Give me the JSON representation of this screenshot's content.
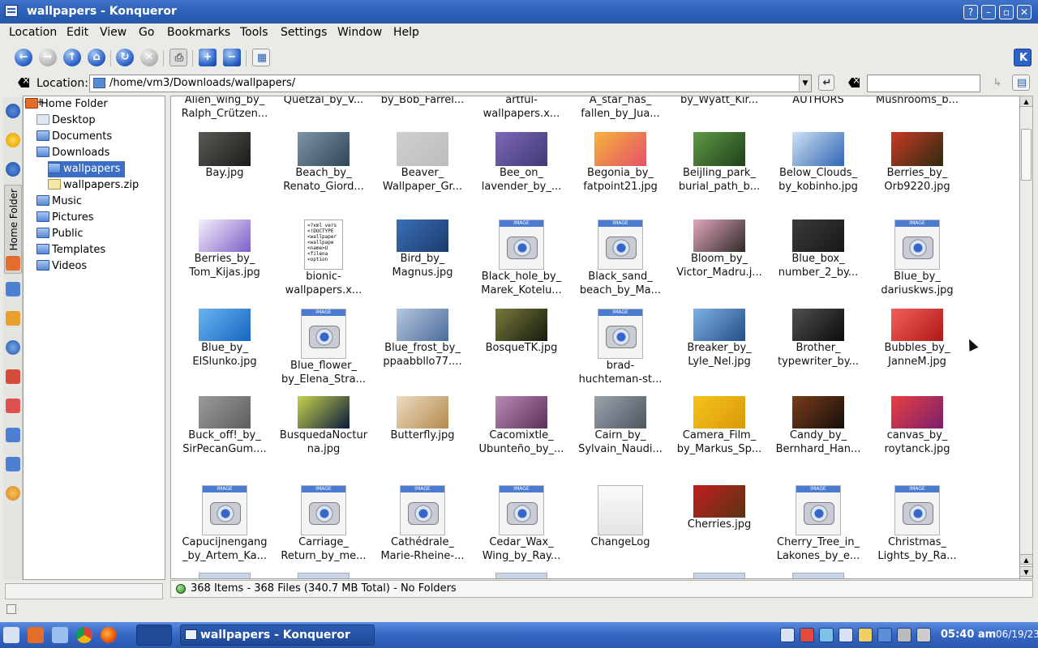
{
  "window": {
    "title": "wallpapers - Konqueror"
  },
  "menu": [
    "Location",
    "Edit",
    "View",
    "Go",
    "Bookmarks",
    "Tools",
    "Settings",
    "Window",
    "Help"
  ],
  "location": {
    "label": "Location:",
    "path": "/home/vm3/Downloads/wallpapers/"
  },
  "sidebar_tab": "Home Folder",
  "tree": [
    {
      "label": "Home Folder"
    },
    {
      "label": "Desktop"
    },
    {
      "label": "Documents"
    },
    {
      "label": "Downloads"
    },
    {
      "label": "wallpapers"
    },
    {
      "label": "wallpapers.zip"
    },
    {
      "label": "Music"
    },
    {
      "label": "Pictures"
    },
    {
      "label": "Public"
    },
    {
      "label": "Templates"
    },
    {
      "label": "Videos"
    }
  ],
  "rows": [
    [
      {
        "l1": "Alien_wing_by_",
        "l2": "Ralph_Crützen..."
      },
      {
        "l1": "Quetzal_by_V...",
        "l2": ""
      },
      {
        "l1": "by_Bob_Farrel...",
        "l2": ""
      },
      {
        "l1": "artful-",
        "l2": "wallpapers.x..."
      },
      {
        "l1": "A_star_has_",
        "l2": "fallen_by_Jua..."
      },
      {
        "l1": "by_Wyatt_Kir...",
        "l2": ""
      },
      {
        "l1": "AUTHORS",
        "l2": ""
      },
      {
        "l1": "Mushrooms_b...",
        "l2": ""
      }
    ],
    [
      {
        "l1": "Bay.jpg",
        "l2": "",
        "c1": "#5b5955",
        "c2": "#1c1b19"
      },
      {
        "l1": "Beach_by_",
        "l2": "Renato_Giord...",
        "c1": "#7f93a6",
        "c2": "#2f4659"
      },
      {
        "l1": "Beaver_",
        "l2": "Wallpaper_Gr...",
        "c1": "#cfcfcf",
        "c2": "#bdbdbd"
      },
      {
        "l1": "Bee_on_",
        "l2": "lavender_by_...",
        "c1": "#7d68b8",
        "c2": "#3f3a75"
      },
      {
        "l1": "Begonia_by_",
        "l2": "fatpoint21.jpg",
        "c1": "#f6b33a",
        "c2": "#e5506a"
      },
      {
        "l1": "Beijling_park_",
        "l2": "burial_path_b...",
        "c1": "#5d9a45",
        "c2": "#20401b"
      },
      {
        "l1": "Below_Clouds_",
        "l2": "by_kobinho.jpg",
        "c1": "#cfe1f6",
        "c2": "#2f66b2"
      },
      {
        "l1": "Berries_by_",
        "l2": "Orb9220.jpg",
        "c1": "#c93a22",
        "c2": "#2d2a12"
      }
    ],
    [
      {
        "l1": "Berries_by_",
        "l2": "Tom_Kijas.jpg",
        "c1": "#f4f0fb",
        "c2": "#7e5fc7"
      },
      {
        "l1": "bionic-",
        "l2": "wallpapers.x..."
      },
      {
        "l1": "Bird_by_",
        "l2": "Magnus.jpg",
        "c1": "#3a6fb7",
        "c2": "#1c3b6c"
      },
      {
        "l1": "Black_hole_by_",
        "l2": "Marek_Kotelu..."
      },
      {
        "l1": "Black_sand_",
        "l2": "beach_by_Ma..."
      },
      {
        "l1": "Bloom_by_",
        "l2": "Victor_Madru.j...",
        "c1": "#e3a6bf",
        "c2": "#2e2a26"
      },
      {
        "l1": "Blue_box_",
        "l2": "number_2_by...",
        "c1": "#3b3b3b",
        "c2": "#171717"
      },
      {
        "l1": "Blue_by_",
        "l2": "dariuskws.jpg"
      }
    ],
    [
      {
        "l1": "Blue_by_",
        "l2": "ElSlunko.jpg",
        "c1": "#6ab4f0",
        "c2": "#1565c2"
      },
      {
        "l1": "Blue_flower_",
        "l2": "by_Elena_Stra..."
      },
      {
        "l1": "Blue_frost_by_",
        "l2": "ppaabbllo77....",
        "c1": "#b6c7de",
        "c2": "#4a6b9a"
      },
      {
        "l1": "BosqueTK.jpg",
        "l2": "",
        "c1": "#7a7a3a",
        "c2": "#141a0d"
      },
      {
        "l1": "brad-",
        "l2": "huchteman-st..."
      },
      {
        "l1": "Breaker_by_",
        "l2": "Lyle_Nel.jpg",
        "c1": "#7db2e8",
        "c2": "#244d85"
      },
      {
        "l1": "Brother_",
        "l2": "typewriter_by...",
        "c1": "#505050",
        "c2": "#0b0b0b"
      },
      {
        "l1": "Bubbles_by_",
        "l2": "JanneM.jpg",
        "c1": "#f2605a",
        "c2": "#b01812"
      }
    ],
    [
      {
        "l1": "Buck_off!_by_",
        "l2": "SirPecanGum....",
        "c1": "#9a9a9a",
        "c2": "#5e5e5e"
      },
      {
        "l1": "BusquedaNoctur",
        "l2": "na.jpg",
        "c1": "#c7d34c",
        "c2": "#0a1a3c"
      },
      {
        "l1": "Butterfly.jpg",
        "l2": "",
        "c1": "#ecdcc3",
        "c2": "#b48a4c"
      },
      {
        "l1": "Cacomixtle_",
        "l2": "Ubunteño_by_...",
        "c1": "#b88bb5",
        "c2": "#5c2f59"
      },
      {
        "l1": "Cairn_by_",
        "l2": "Sylvain_Naudi...",
        "c1": "#9aa4ad",
        "c2": "#4d5660"
      },
      {
        "l1": "Camera_Film_",
        "l2": "by_Markus_Sp...",
        "c1": "#f7c21a",
        "c2": "#d89a0a"
      },
      {
        "l1": "Candy_by_",
        "l2": "Bernhard_Han...",
        "c1": "#7a3c18",
        "c2": "#14100c"
      },
      {
        "l1": "canvas_by_",
        "l2": "roytanck.jpg",
        "c1": "#e8403f",
        "c2": "#7a1f6e"
      }
    ],
    [
      {
        "l1": "Capucijnengang",
        "l2": "_by_Artem_Ka..."
      },
      {
        "l1": "Carriage_",
        "l2": "Return_by_me..."
      },
      {
        "l1": "Cathédrale_",
        "l2": "Marie-Rheine-..."
      },
      {
        "l1": "Cedar_Wax_",
        "l2": "Wing_by_Ray..."
      },
      {
        "l1": "ChangeLog",
        "l2": ""
      },
      {
        "l1": "Cherries.jpg",
        "l2": "",
        "c1": "#c01e1e",
        "c2": "#5a3414"
      },
      {
        "l1": "Cherry_Tree_in_",
        "l2": "Lakones_by_e..."
      },
      {
        "l1": "Christmas_",
        "l2": "Lights_by_Ra..."
      }
    ]
  ],
  "bionic_lines": [
    "<?xml vers",
    "<!DOCTYPE",
    "<wallpaper",
    "<wallpape",
    "  <name>U",
    "  <filena",
    "  <option"
  ],
  "status": {
    "text": "368 Items - 368 Files (340.7 MB Total) - No Folders"
  },
  "taskbar": {
    "task_title": "wallpapers - Konqueror",
    "time": "05:40 am",
    "date": "06/19/23"
  }
}
